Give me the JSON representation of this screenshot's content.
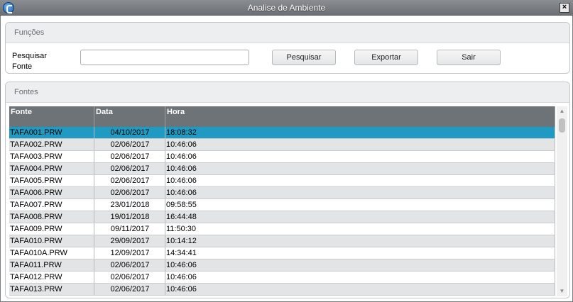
{
  "window": {
    "title": "Analise de Ambiente",
    "close_glyph": "×"
  },
  "functions_group": {
    "header": "Funções",
    "search_label": "Pesquisar Fonte",
    "search_value": "",
    "buttons": {
      "search": "Pesquisar",
      "export": "Exportar",
      "exit": "Sair"
    }
  },
  "fontes_group": {
    "header": "Fontes",
    "columns": [
      "Fonte",
      "Data",
      "Hora"
    ],
    "rows": [
      [
        "TAFA001.PRW",
        "04/10/2017",
        "18:08:32"
      ],
      [
        "TAFA002.PRW",
        "02/06/2017",
        "10:46:06"
      ],
      [
        "TAFA003.PRW",
        "02/06/2017",
        "10:46:06"
      ],
      [
        "TAFA004.PRW",
        "02/06/2017",
        "10:46:06"
      ],
      [
        "TAFA005.PRW",
        "02/06/2017",
        "10:46:06"
      ],
      [
        "TAFA006.PRW",
        "02/06/2017",
        "10:46:06"
      ],
      [
        "TAFA007.PRW",
        "23/01/2018",
        "09:58:55"
      ],
      [
        "TAFA008.PRW",
        "19/01/2018",
        "16:44:48"
      ],
      [
        "TAFA009.PRW",
        "09/11/2017",
        "11:50:30"
      ],
      [
        "TAFA010.PRW",
        "29/09/2017",
        "10:14:12"
      ],
      [
        "TAFA010A.PRW",
        "12/09/2017",
        "14:34:41"
      ],
      [
        "TAFA011.PRW",
        "02/06/2017",
        "10:46:06"
      ],
      [
        "TAFA012.PRW",
        "02/06/2017",
        "10:46:06"
      ],
      [
        "TAFA013.PRW",
        "02/06/2017",
        "10:46:06"
      ]
    ],
    "selected_row": 0
  },
  "icons": {
    "app": "totvs-app-icon",
    "close": "close-icon",
    "scroll_up": "scroll-up-icon",
    "scroll_down": "scroll-down-icon"
  },
  "colors": {
    "titlebar": "#6c7075",
    "grid_header": "#6d7377",
    "selected_row": "#1f9bc3"
  }
}
